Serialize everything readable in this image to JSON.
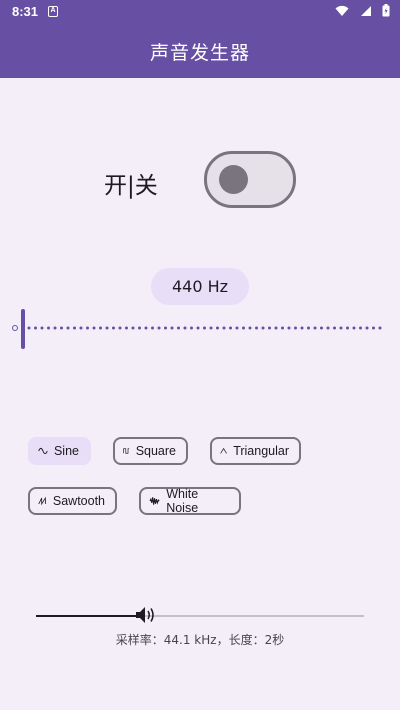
{
  "status_bar": {
    "time": "8:31",
    "notification_icon": "a-notification-icon",
    "icons": [
      "wifi-icon",
      "signal-icon",
      "battery-icon"
    ]
  },
  "app_bar": {
    "title": "声音发生器"
  },
  "power": {
    "label": "开|关",
    "state": "off"
  },
  "frequency": {
    "value_label": "440 Hz",
    "slider_position": 0.0
  },
  "waveforms": {
    "selected": "Sine",
    "options": [
      {
        "label": "Sine",
        "icon": "sine-wave-icon"
      },
      {
        "label": "Square",
        "icon": "square-wave-icon"
      },
      {
        "label": "Triangular",
        "icon": "triangle-wave-icon"
      },
      {
        "label": "Sawtooth",
        "icon": "sawtooth-wave-icon"
      },
      {
        "label": "White Noise",
        "icon": "white-noise-icon"
      }
    ]
  },
  "volume": {
    "level": 0.33,
    "icon": "speaker-icon"
  },
  "info": {
    "text": "采样率：44.1 kHz，长度：2秒"
  },
  "colors": {
    "primary": "#6750a4",
    "background": "#f3eef8",
    "chip_selected": "#e8def8",
    "outline": "#79747e"
  }
}
